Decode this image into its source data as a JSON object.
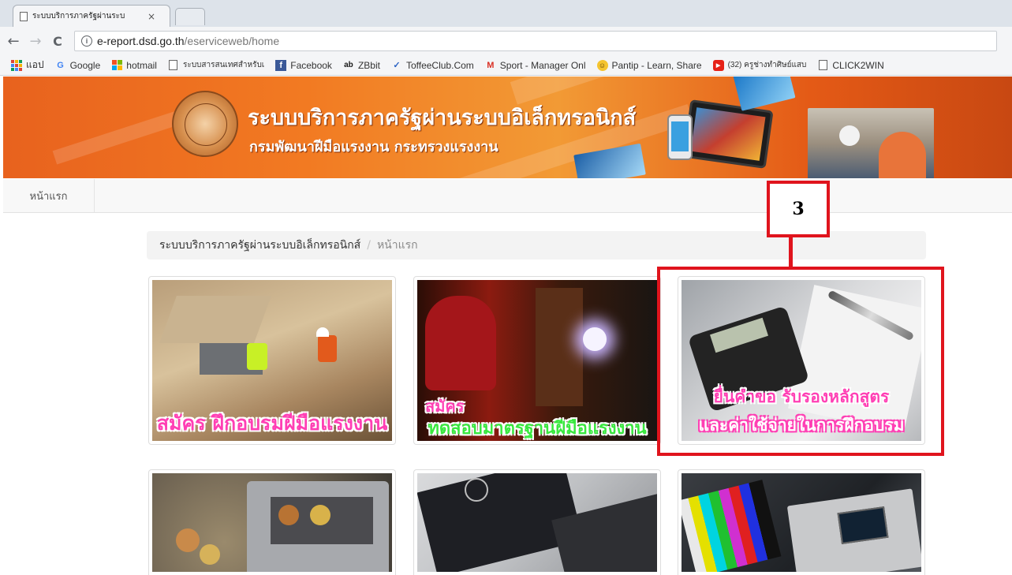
{
  "browser": {
    "tab_title": "ระบบบริการภาครัฐผ่านระบ",
    "tab_close": "×",
    "nav_back": "←",
    "nav_forward": "→",
    "nav_reload": "C",
    "info_icon_glyph": "i",
    "url_host": "e-report.dsd.go.th",
    "url_path": "/eserviceweb/home"
  },
  "bookmarks": [
    {
      "label": "แอป",
      "icon": "apps-icon"
    },
    {
      "label": "Google",
      "icon": "google-icon"
    },
    {
      "label": "hotmail",
      "icon": "windows-icon"
    },
    {
      "label": "ระบบสารสนเทศสำหรับเ",
      "icon": "page-icon"
    },
    {
      "label": "Facebook",
      "icon": "facebook-icon"
    },
    {
      "label": "ZBbit",
      "icon": "zbbit-icon"
    },
    {
      "label": "ToffeeClub.Com",
      "icon": "toffee-icon"
    },
    {
      "label": "Sport - Manager Onl",
      "icon": "gmail-icon"
    },
    {
      "label": "Pantip - Learn, Share",
      "icon": "pantip-icon"
    },
    {
      "label": "(32) ครูช่างทำศิษย์แสบ",
      "icon": "youtube-icon"
    },
    {
      "label": "CLICK2WIN",
      "icon": "page-icon"
    }
  ],
  "banner": {
    "title": "ระบบบริการภาครัฐผ่านระบบอิเล็กทรอนิกส์",
    "subtitle": "กรมพัฒนาฝีมือแรงงาน กระทรวงแรงงาน"
  },
  "navbar": {
    "home_label": "หน้าแรก"
  },
  "breadcrumb": {
    "root": "ระบบบริการภาครัฐผ่านระบบอิเล็กทรอนิกส์",
    "separator": "/",
    "current": "หน้าแรก"
  },
  "cards": [
    {
      "line1": "สมัคร ฝึกอบรมฝีมือแรงงาน",
      "line2": "",
      "icon": "construction-workers-image"
    },
    {
      "line1": "สมัคร",
      "line2": "ทดสอบมาตรฐานฝีมือแรงงาน",
      "icon": "welder-image"
    },
    {
      "line1": "ยื่นคำขอ รับรองหลักสูตร",
      "line2": "และค่าใช้จ่ายในการฝึกอบรม",
      "icon": "calculator-image"
    },
    {
      "line1": "",
      "line2": "",
      "icon": "coin-box-image"
    },
    {
      "line1": "",
      "line2": "",
      "icon": "laptop-passport-image"
    },
    {
      "line1": "",
      "line2": "",
      "icon": "electronics-lab-image"
    }
  ],
  "annotation": {
    "number": "3",
    "color": "#e0141d"
  },
  "colors": {
    "banner_orange": "#f27a22",
    "caption_pink": "#ff3fb4",
    "caption_green": "#39e83f",
    "caption_white": "#ffffff"
  }
}
